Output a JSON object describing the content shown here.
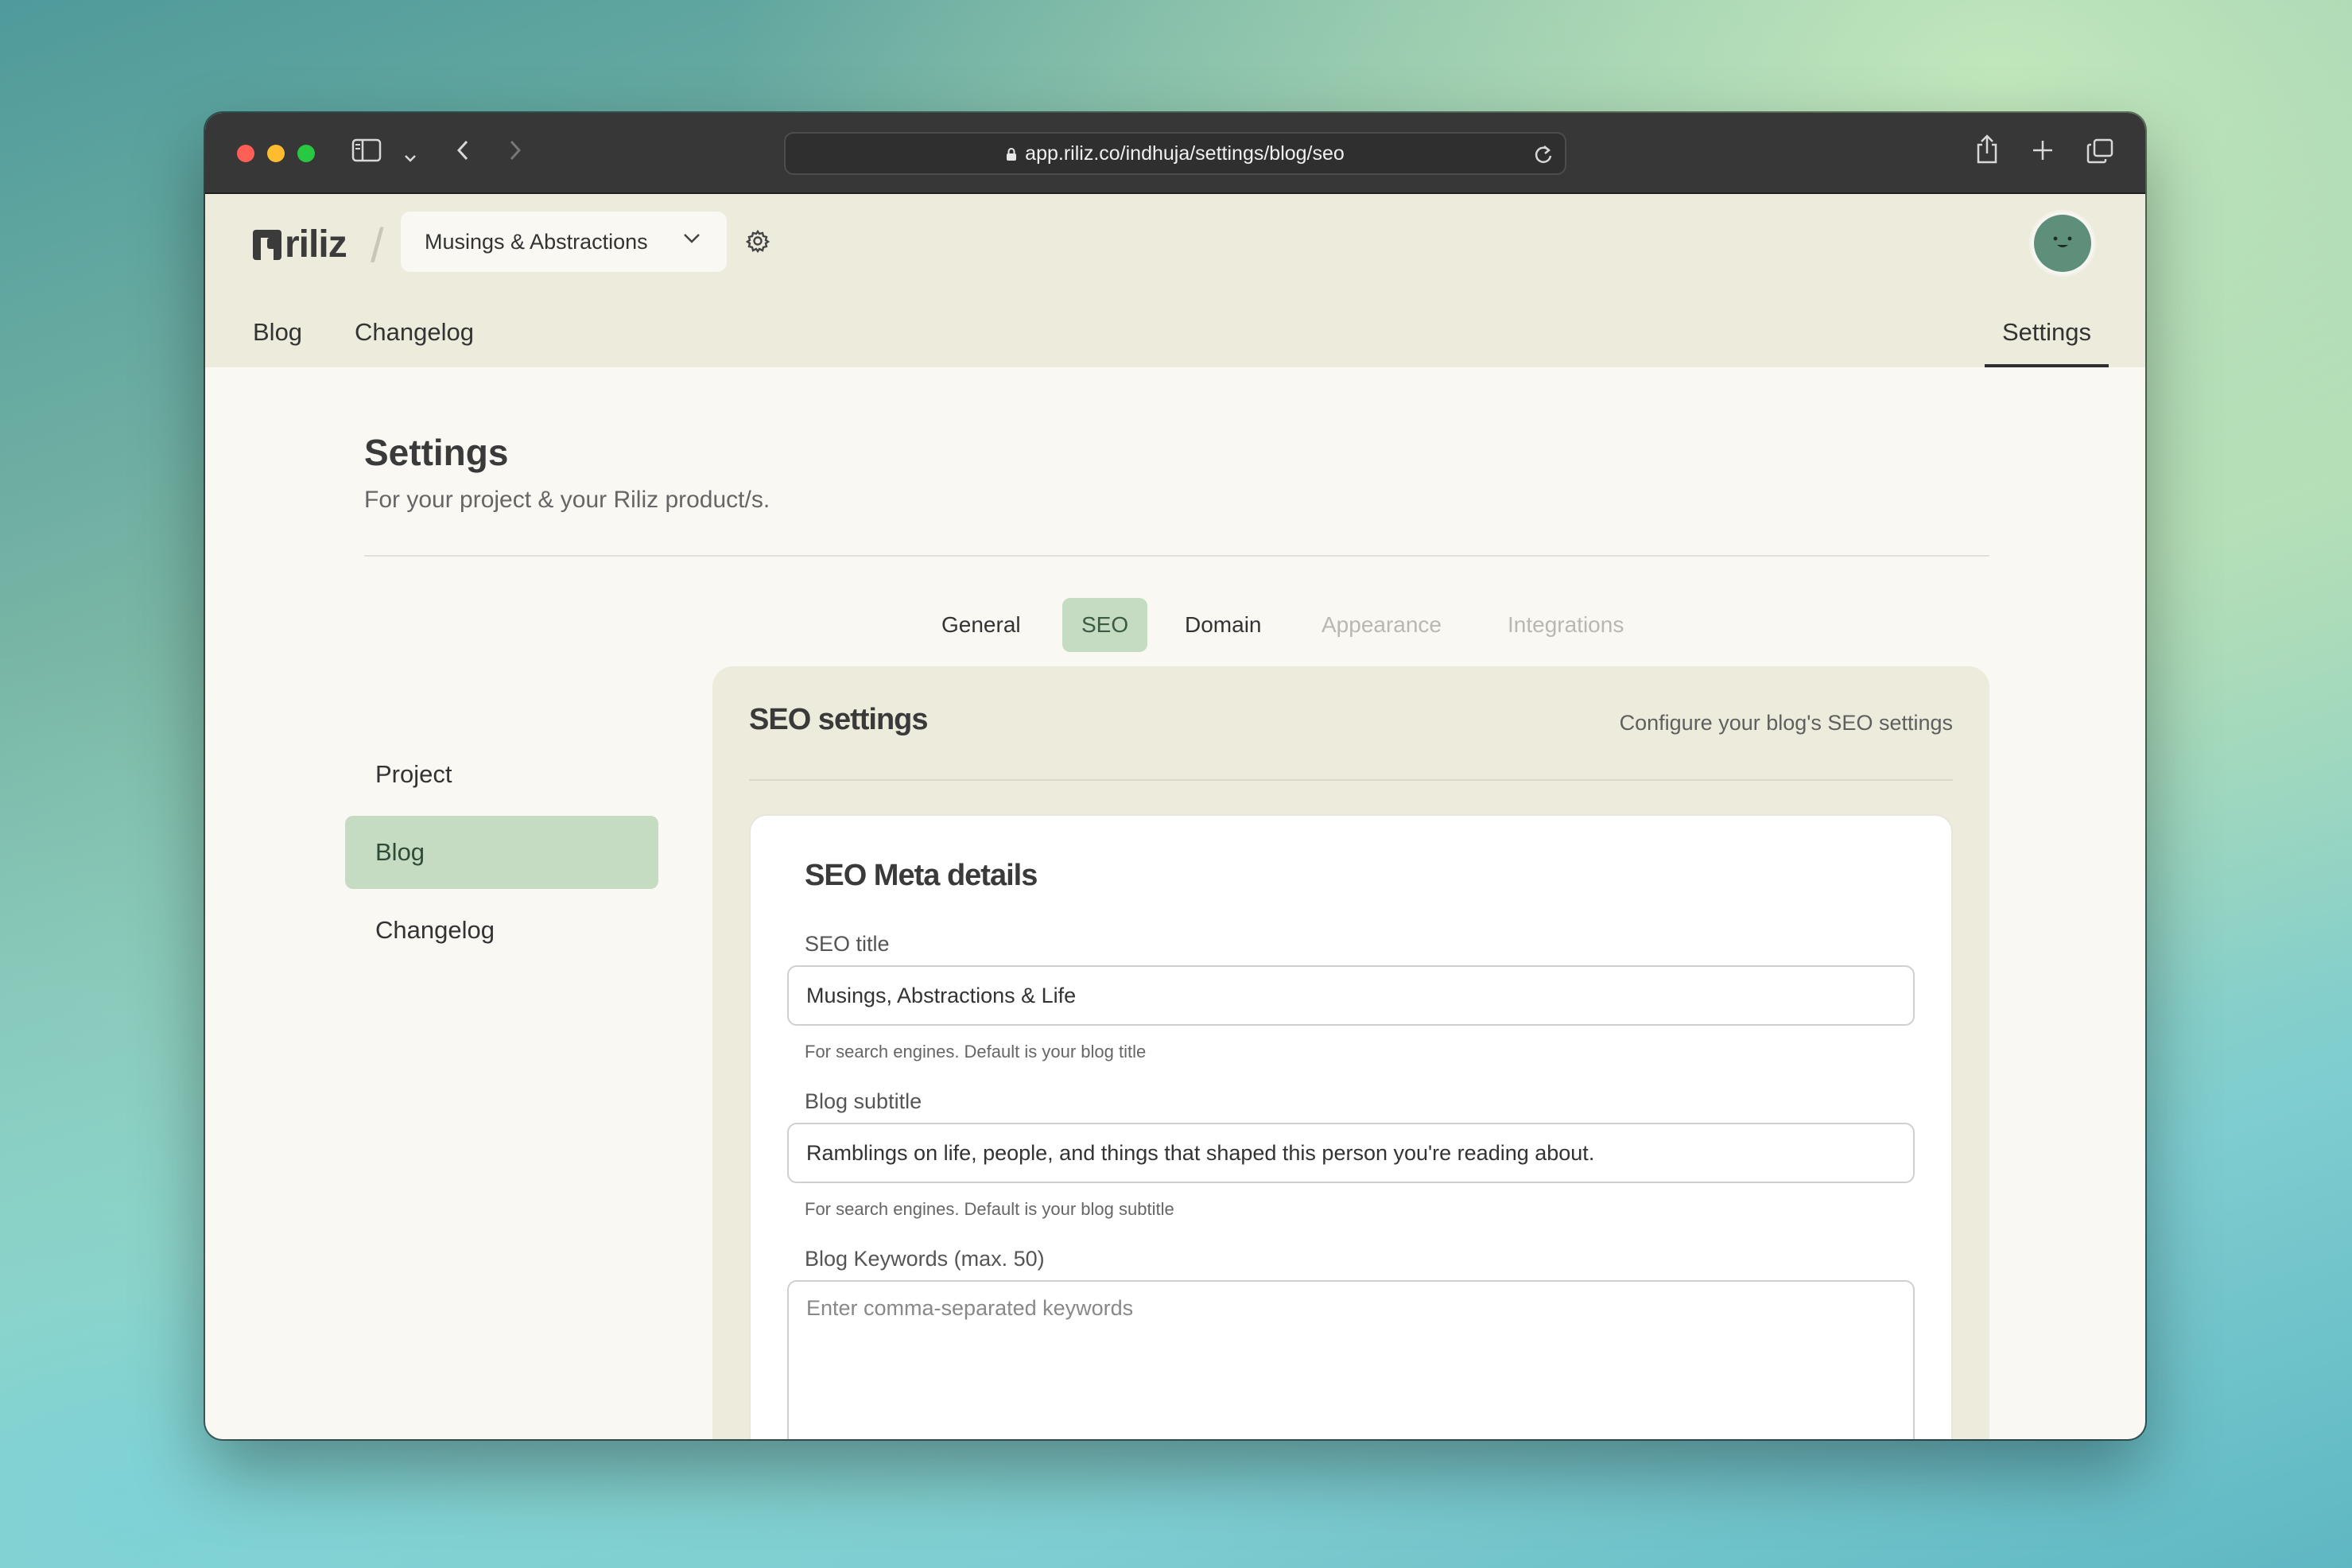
{
  "browser": {
    "url": "app.riliz.co/indhuja/settings/blog/seo"
  },
  "header": {
    "logo_text": "riliz",
    "project_name": "Musings & Abstractions",
    "nav": {
      "blog": "Blog",
      "changelog": "Changelog",
      "settings": "Settings"
    }
  },
  "page": {
    "title": "Settings",
    "subtitle": "For your project & your Riliz product/s."
  },
  "sidebar": {
    "items": [
      {
        "label": "Project"
      },
      {
        "label": "Blog"
      },
      {
        "label": "Changelog"
      }
    ],
    "active": "Blog"
  },
  "tabs": [
    {
      "label": "General",
      "state": "normal"
    },
    {
      "label": "SEO",
      "state": "active"
    },
    {
      "label": "Domain",
      "state": "normal"
    },
    {
      "label": "Appearance",
      "state": "disabled"
    },
    {
      "label": "Integrations",
      "state": "disabled"
    }
  ],
  "panel": {
    "title": "SEO settings",
    "description": "Configure your blog's SEO settings"
  },
  "card": {
    "title": "SEO Meta details",
    "seo_title": {
      "label": "SEO title",
      "value": "Musings, Abstractions & Life",
      "help": "For search engines. Default is your blog title"
    },
    "blog_subtitle": {
      "label": "Blog subtitle",
      "value": "Ramblings on life, people, and things that shaped this person you're reading about.",
      "help": "For search engines. Default is your blog subtitle"
    },
    "keywords": {
      "label": "Blog Keywords (max. 50)",
      "placeholder": "Enter comma-separated keywords"
    }
  },
  "colors": {
    "accent_green": "#c5dcc3",
    "header_bg": "#edebdc",
    "page_bg": "#faf8f3"
  }
}
